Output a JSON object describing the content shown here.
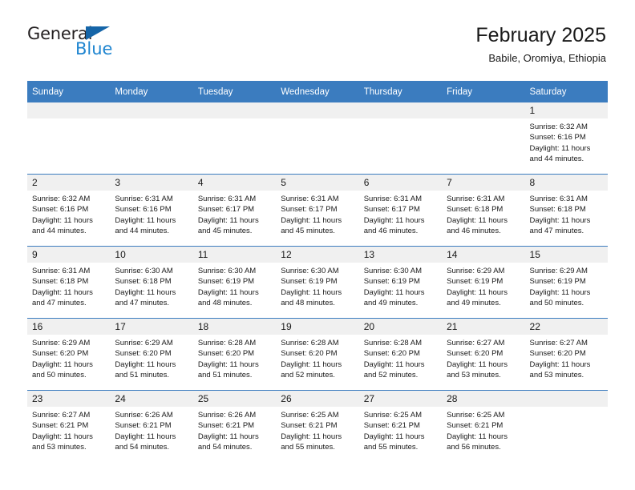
{
  "logo": {
    "word_one": "General",
    "word_two": "Blue",
    "triangle_color": "#1565a8",
    "blue_color": "#1f85d0"
  },
  "header": {
    "title": "February 2025",
    "subtitle": "Babile, Oromiya, Ethiopia"
  },
  "theme": {
    "header_bg": "#3b7cbf",
    "daynum_bg": "#f0f0f0",
    "grid_line": "#3b7cbf"
  },
  "weekdays": [
    "Sunday",
    "Monday",
    "Tuesday",
    "Wednesday",
    "Thursday",
    "Friday",
    "Saturday"
  ],
  "labels": {
    "sunrise": "Sunrise:",
    "sunset": "Sunset:",
    "daylight": "Daylight:"
  },
  "weeks": [
    [
      {
        "day": "",
        "empty": true
      },
      {
        "day": "",
        "empty": true
      },
      {
        "day": "",
        "empty": true
      },
      {
        "day": "",
        "empty": true
      },
      {
        "day": "",
        "empty": true
      },
      {
        "day": "",
        "empty": true
      },
      {
        "day": "1",
        "sunrise": "Sunrise: 6:32 AM",
        "sunset": "Sunset: 6:16 PM",
        "daylight": "Daylight: 11 hours and 44 minutes."
      }
    ],
    [
      {
        "day": "2",
        "sunrise": "Sunrise: 6:32 AM",
        "sunset": "Sunset: 6:16 PM",
        "daylight": "Daylight: 11 hours and 44 minutes."
      },
      {
        "day": "3",
        "sunrise": "Sunrise: 6:31 AM",
        "sunset": "Sunset: 6:16 PM",
        "daylight": "Daylight: 11 hours and 44 minutes."
      },
      {
        "day": "4",
        "sunrise": "Sunrise: 6:31 AM",
        "sunset": "Sunset: 6:17 PM",
        "daylight": "Daylight: 11 hours and 45 minutes."
      },
      {
        "day": "5",
        "sunrise": "Sunrise: 6:31 AM",
        "sunset": "Sunset: 6:17 PM",
        "daylight": "Daylight: 11 hours and 45 minutes."
      },
      {
        "day": "6",
        "sunrise": "Sunrise: 6:31 AM",
        "sunset": "Sunset: 6:17 PM",
        "daylight": "Daylight: 11 hours and 46 minutes."
      },
      {
        "day": "7",
        "sunrise": "Sunrise: 6:31 AM",
        "sunset": "Sunset: 6:18 PM",
        "daylight": "Daylight: 11 hours and 46 minutes."
      },
      {
        "day": "8",
        "sunrise": "Sunrise: 6:31 AM",
        "sunset": "Sunset: 6:18 PM",
        "daylight": "Daylight: 11 hours and 47 minutes."
      }
    ],
    [
      {
        "day": "9",
        "sunrise": "Sunrise: 6:31 AM",
        "sunset": "Sunset: 6:18 PM",
        "daylight": "Daylight: 11 hours and 47 minutes."
      },
      {
        "day": "10",
        "sunrise": "Sunrise: 6:30 AM",
        "sunset": "Sunset: 6:18 PM",
        "daylight": "Daylight: 11 hours and 47 minutes."
      },
      {
        "day": "11",
        "sunrise": "Sunrise: 6:30 AM",
        "sunset": "Sunset: 6:19 PM",
        "daylight": "Daylight: 11 hours and 48 minutes."
      },
      {
        "day": "12",
        "sunrise": "Sunrise: 6:30 AM",
        "sunset": "Sunset: 6:19 PM",
        "daylight": "Daylight: 11 hours and 48 minutes."
      },
      {
        "day": "13",
        "sunrise": "Sunrise: 6:30 AM",
        "sunset": "Sunset: 6:19 PM",
        "daylight": "Daylight: 11 hours and 49 minutes."
      },
      {
        "day": "14",
        "sunrise": "Sunrise: 6:29 AM",
        "sunset": "Sunset: 6:19 PM",
        "daylight": "Daylight: 11 hours and 49 minutes."
      },
      {
        "day": "15",
        "sunrise": "Sunrise: 6:29 AM",
        "sunset": "Sunset: 6:19 PM",
        "daylight": "Daylight: 11 hours and 50 minutes."
      }
    ],
    [
      {
        "day": "16",
        "sunrise": "Sunrise: 6:29 AM",
        "sunset": "Sunset: 6:20 PM",
        "daylight": "Daylight: 11 hours and 50 minutes."
      },
      {
        "day": "17",
        "sunrise": "Sunrise: 6:29 AM",
        "sunset": "Sunset: 6:20 PM",
        "daylight": "Daylight: 11 hours and 51 minutes."
      },
      {
        "day": "18",
        "sunrise": "Sunrise: 6:28 AM",
        "sunset": "Sunset: 6:20 PM",
        "daylight": "Daylight: 11 hours and 51 minutes."
      },
      {
        "day": "19",
        "sunrise": "Sunrise: 6:28 AM",
        "sunset": "Sunset: 6:20 PM",
        "daylight": "Daylight: 11 hours and 52 minutes."
      },
      {
        "day": "20",
        "sunrise": "Sunrise: 6:28 AM",
        "sunset": "Sunset: 6:20 PM",
        "daylight": "Daylight: 11 hours and 52 minutes."
      },
      {
        "day": "21",
        "sunrise": "Sunrise: 6:27 AM",
        "sunset": "Sunset: 6:20 PM",
        "daylight": "Daylight: 11 hours and 53 minutes."
      },
      {
        "day": "22",
        "sunrise": "Sunrise: 6:27 AM",
        "sunset": "Sunset: 6:20 PM",
        "daylight": "Daylight: 11 hours and 53 minutes."
      }
    ],
    [
      {
        "day": "23",
        "sunrise": "Sunrise: 6:27 AM",
        "sunset": "Sunset: 6:21 PM",
        "daylight": "Daylight: 11 hours and 53 minutes."
      },
      {
        "day": "24",
        "sunrise": "Sunrise: 6:26 AM",
        "sunset": "Sunset: 6:21 PM",
        "daylight": "Daylight: 11 hours and 54 minutes."
      },
      {
        "day": "25",
        "sunrise": "Sunrise: 6:26 AM",
        "sunset": "Sunset: 6:21 PM",
        "daylight": "Daylight: 11 hours and 54 minutes."
      },
      {
        "day": "26",
        "sunrise": "Sunrise: 6:25 AM",
        "sunset": "Sunset: 6:21 PM",
        "daylight": "Daylight: 11 hours and 55 minutes."
      },
      {
        "day": "27",
        "sunrise": "Sunrise: 6:25 AM",
        "sunset": "Sunset: 6:21 PM",
        "daylight": "Daylight: 11 hours and 55 minutes."
      },
      {
        "day": "28",
        "sunrise": "Sunrise: 6:25 AM",
        "sunset": "Sunset: 6:21 PM",
        "daylight": "Daylight: 11 hours and 56 minutes."
      },
      {
        "day": "",
        "empty": true
      }
    ]
  ]
}
